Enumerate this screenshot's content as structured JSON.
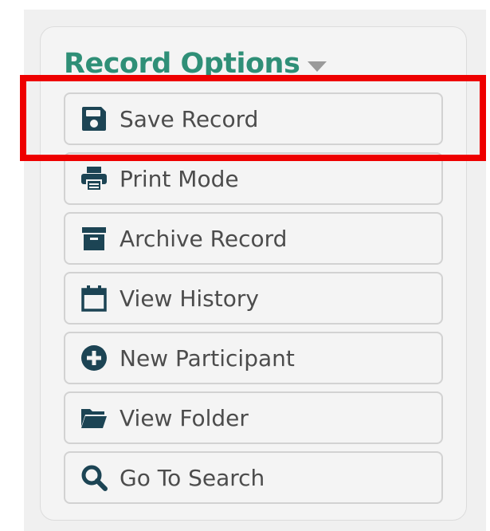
{
  "panel": {
    "title": "Record Options"
  },
  "buttons": [
    {
      "label": "Save Record",
      "icon": "save-icon"
    },
    {
      "label": "Print Mode",
      "icon": "print-icon"
    },
    {
      "label": "Archive Record",
      "icon": "archive-icon"
    },
    {
      "label": "View History",
      "icon": "calendar-icon"
    },
    {
      "label": "New Participant",
      "icon": "plus-circle-icon"
    },
    {
      "label": "View Folder",
      "icon": "folder-icon"
    },
    {
      "label": "Go To Search",
      "icon": "search-icon"
    }
  ],
  "colors": {
    "title": "#2f8f77",
    "icon": "#1c4454",
    "label": "#4c4c4c",
    "highlight": "#ee0000"
  }
}
